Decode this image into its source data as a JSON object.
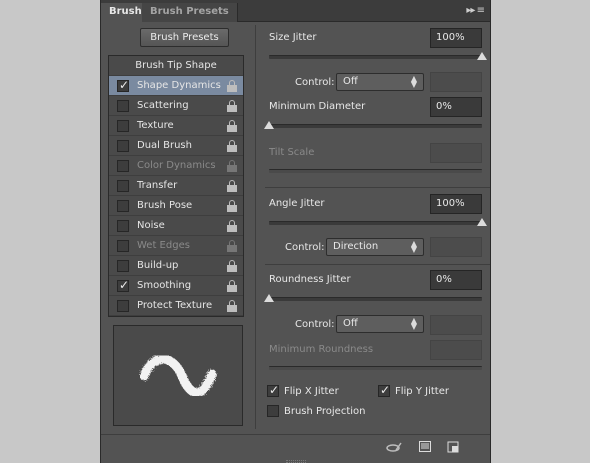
{
  "tabs": [
    "Brush",
    "Brush Presets"
  ],
  "tabbar_icons": "▸▸ ≡",
  "brush_presets_button": "Brush Presets",
  "list": {
    "header": "Brush Tip Shape",
    "items": [
      {
        "label": "Shape Dynamics",
        "checked": true,
        "selected": true,
        "enabled": true
      },
      {
        "label": "Scattering",
        "checked": false,
        "enabled": true
      },
      {
        "label": "Texture",
        "checked": false,
        "enabled": true
      },
      {
        "label": "Dual Brush",
        "checked": false,
        "enabled": true
      },
      {
        "label": "Color Dynamics",
        "checked": false,
        "enabled": false
      },
      {
        "label": "Transfer",
        "checked": false,
        "enabled": true
      },
      {
        "label": "Brush Pose",
        "checked": false,
        "enabled": true
      },
      {
        "label": "Noise",
        "checked": false,
        "enabled": true
      },
      {
        "label": "Wet Edges",
        "checked": false,
        "enabled": false
      },
      {
        "label": "Build-up",
        "checked": false,
        "enabled": true
      },
      {
        "label": "Smoothing",
        "checked": true,
        "enabled": true
      },
      {
        "label": "Protect Texture",
        "checked": false,
        "enabled": true
      }
    ]
  },
  "settings": {
    "size_jitter": {
      "label": "Size Jitter",
      "value": "100%",
      "level": 1.0
    },
    "control1": {
      "label": "Control:",
      "value": "Off"
    },
    "min_diameter": {
      "label": "Minimum Diameter",
      "value": "0%",
      "level": 0.0
    },
    "tilt_scale": {
      "label": "Tilt Scale"
    },
    "angle_jitter": {
      "label": "Angle Jitter",
      "value": "100%",
      "level": 1.0
    },
    "control2": {
      "label": "Control:",
      "value": "Direction"
    },
    "roundness_jitter": {
      "label": "Roundness Jitter",
      "value": "0%",
      "level": 0.0
    },
    "control3": {
      "label": "Control:",
      "value": "Off"
    },
    "min_roundness": {
      "label": "Minimum Roundness"
    },
    "flip_x": {
      "label": "Flip X Jitter",
      "checked": true
    },
    "flip_y": {
      "label": "Flip Y Jitter",
      "checked": true
    },
    "brush_projection": {
      "label": "Brush Projection",
      "checked": false
    }
  },
  "colors": {
    "panel": "#535353",
    "selected_row": "#7a8aa0",
    "tabbar": "#3c3c3c"
  }
}
